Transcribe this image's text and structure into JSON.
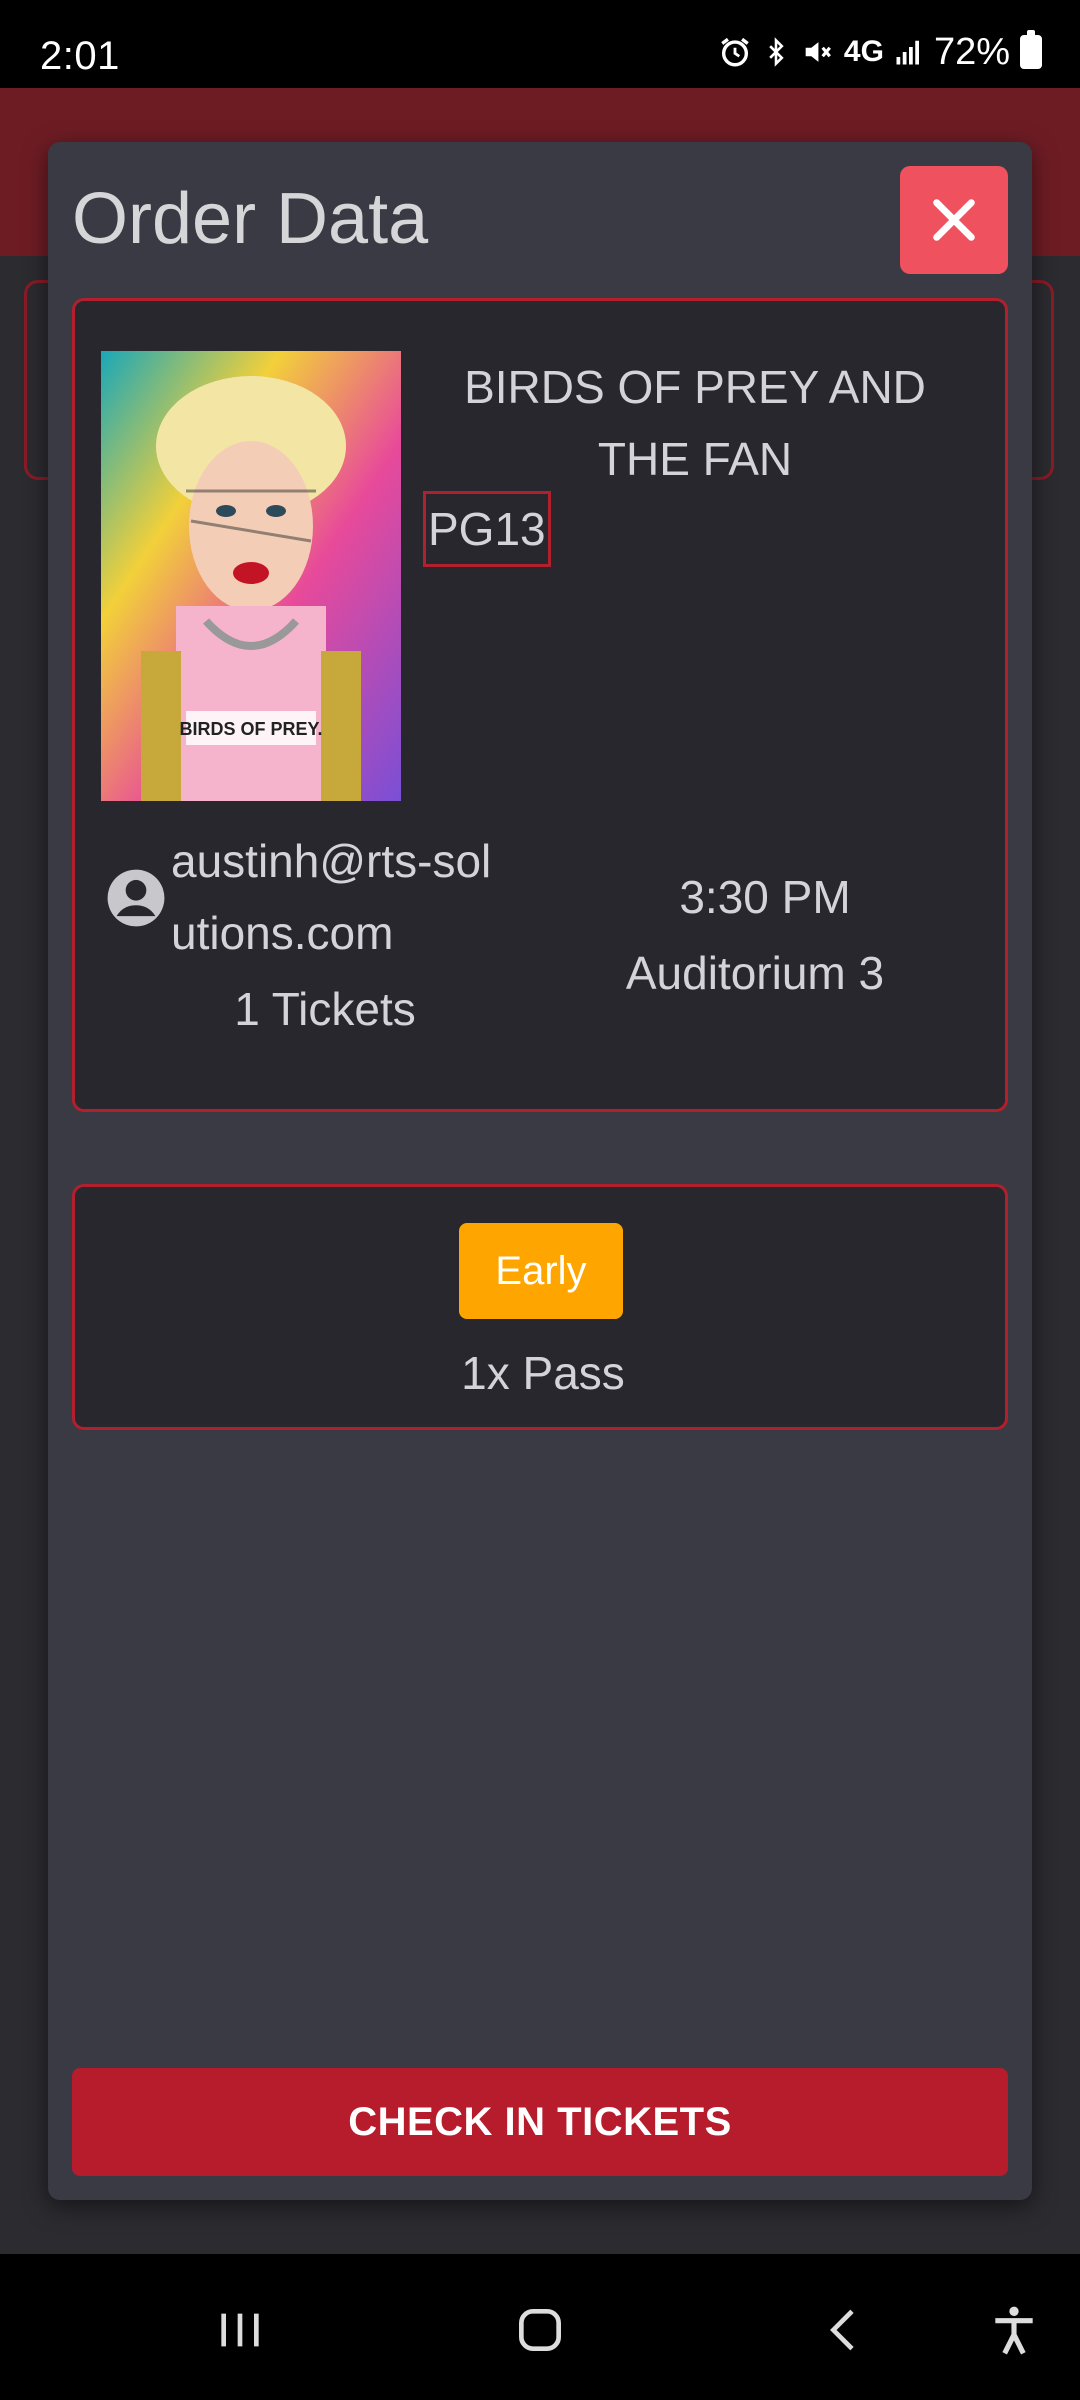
{
  "status_bar": {
    "time": "2:01",
    "network": "4G",
    "battery": "72%"
  },
  "modal": {
    "title": "Order Data",
    "close_icon": "close-icon"
  },
  "movie": {
    "title": "BIRDS OF PREY AND THE FAN",
    "rating": "PG13",
    "poster_text": "BIRDS OF PREY."
  },
  "order": {
    "email": "austinh@rts-solutions.com",
    "showtime": "3:30 PM",
    "tickets": "1 Tickets",
    "auditorium": "Auditorium 3"
  },
  "pass": {
    "badge": "Early",
    "label": "1x Pass"
  },
  "actions": {
    "checkin_label": "CHECK IN TICKETS"
  },
  "colors": {
    "accent": "#b61c2c",
    "close": "#f0515f",
    "badge": "#ffa500"
  }
}
